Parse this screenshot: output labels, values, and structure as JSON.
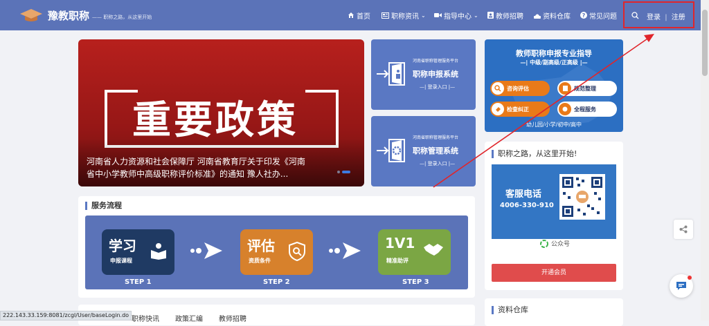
{
  "nav": {
    "logo_text": "豫教职称",
    "slogan": "—— 职称之路，从这里开始",
    "items": [
      {
        "label": "首页",
        "icon": "home-icon"
      },
      {
        "label": "职称资讯",
        "icon": "news-icon",
        "dropdown": true
      },
      {
        "label": "指导中心",
        "icon": "video-icon",
        "dropdown": true
      },
      {
        "label": "教师招聘",
        "icon": "id-card-icon"
      },
      {
        "label": "资料仓库",
        "icon": "database-icon"
      },
      {
        "label": "常见问题",
        "icon": "question-icon"
      }
    ],
    "login_label": "登录",
    "divider": "|",
    "register_label": "注册"
  },
  "banner": {
    "big_text": "重要政策",
    "caption": "河南省人力资源和社会保障厅 河南省教育厅关于印发《河南省中小学教师中高级职称评价标准》的通知 豫人社办..."
  },
  "systems": [
    {
      "platform": "河南省职称管理服务平台",
      "title": "职称申报系统",
      "entry": "—| 登录入口 |—"
    },
    {
      "platform": "河南省职称管理服务平台",
      "title": "职称管理系统",
      "entry": "—| 登录入口 |—"
    }
  ],
  "guide": {
    "title": "教师职称申报专业指导",
    "subtitle": "—| 中级/副高级/正高级 |—",
    "buttons": [
      "咨询评估",
      "规范整理",
      "检查纠正",
      "全程服务"
    ],
    "footer": "幼儿园/小学/初中/高中"
  },
  "service": {
    "title": "服务流程",
    "steps": [
      {
        "big": "学习",
        "small": "申报课程",
        "label": "STEP 1",
        "color": "#1f3a63"
      },
      {
        "big": "评估",
        "small": "资质条件",
        "label": "STEP 2",
        "color": "#d7812c"
      },
      {
        "big": "1V1",
        "small": "精准助评",
        "label": "STEP 3",
        "color": "#7ba644"
      }
    ]
  },
  "contact": {
    "heading": "职称之路，从这里开始!",
    "phone_title": "客服电话",
    "phone": "4006-330-910",
    "wechat": "公众号",
    "member_button": "开通会员"
  },
  "resources": {
    "title": "资料仓库"
  },
  "bottom_tabs": [
    "职称快讯",
    "政策汇编",
    "教师招聘"
  ],
  "status_url": "222.143.33.159:8081/zcgl/User/baseLogin.do",
  "annotation_color": "#e0252b",
  "accent": "#5b73b8"
}
